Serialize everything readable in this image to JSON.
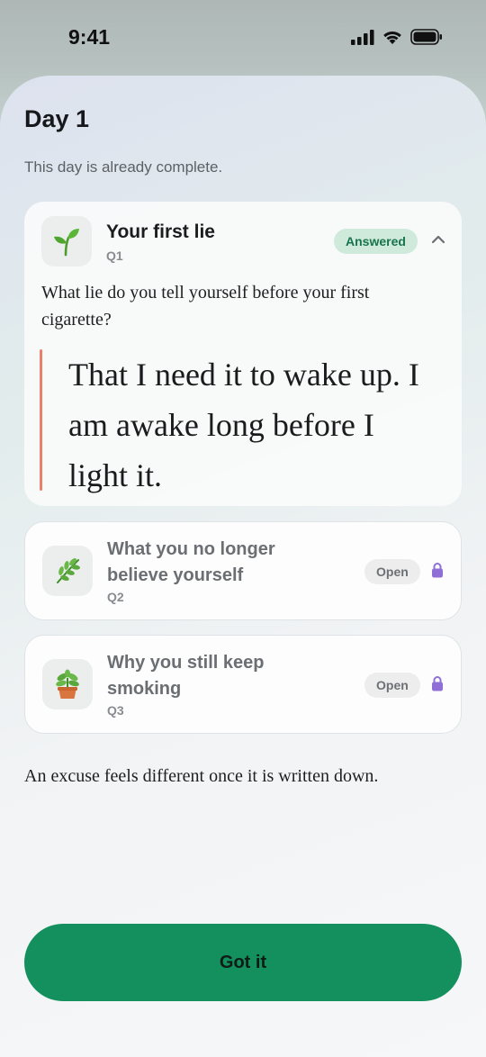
{
  "status": {
    "time": "9:41"
  },
  "sheet": {
    "title": "Day 1",
    "subtitle": "This day is already complete."
  },
  "questions": [
    {
      "title": "Your first lie",
      "number": "Q1",
      "status": "Answered",
      "icon": "seedling-icon",
      "prompt": "What lie do you tell yourself before your first cigarette?",
      "answer": "That I need it to wake up. I am awake long before I light it."
    },
    {
      "title": "What you no longer believe yourself",
      "number": "Q2",
      "status": "Open",
      "icon": "herb-icon"
    },
    {
      "title": "Why you still keep smoking",
      "number": "Q3",
      "status": "Open",
      "icon": "potted-plant-icon"
    }
  ],
  "footer": {
    "note": "An excuse feels different once it is written down."
  },
  "cta": {
    "label": "Got it"
  },
  "colors": {
    "accent": "#14905e",
    "answered_badge_bg": "#cfeadb",
    "answered_badge_text": "#17744c",
    "answer_bar": "#e98068",
    "lock": "#8f6fd6"
  }
}
